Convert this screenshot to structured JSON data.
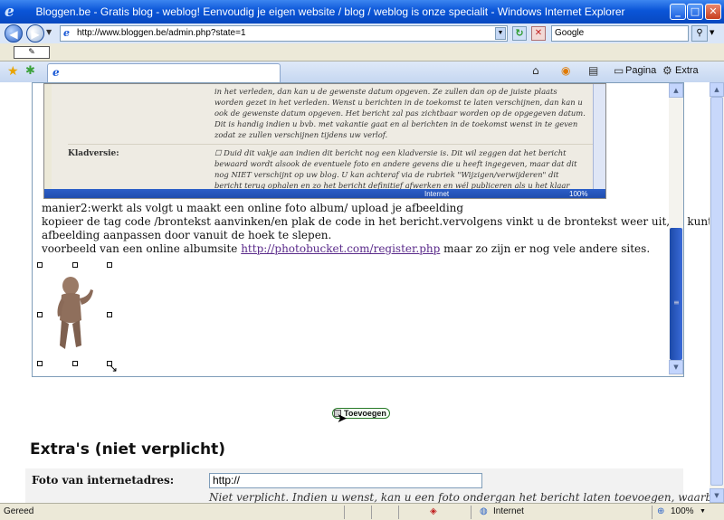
{
  "window": {
    "title": "Bloggen.be - Gratis blog - weblog! Eenvoudig je eigen website / blog / weblog is onze specialit - Windows Internet Explorer",
    "minimize_icon": "minimize-icon",
    "maximize_icon": "maximize-icon",
    "close_icon": "close-icon"
  },
  "navigation": {
    "url": "http://www.bloggen.be/admin.php?state=1",
    "search_value": "Google"
  },
  "tab": {
    "label": ""
  },
  "toolbar": {
    "page_label": "Pagina",
    "extra_label": "Extra"
  },
  "screenshot_embed": {
    "top_text": "in het verleden, dan kan u de gewenste datum opgeven. Ze zullen dan op de juiste plaats worden gezet in het verleden. Wenst u berichten in de toekomst te laten verschijnen, dan kan u ook de gewenste datum opgeven. Het bericht zal pas zichtbaar worden op de opgegeven datum. Dit is handig indien u bvb. met vakantie gaat en al berichten in de toekomst wenst in te geven zodat ze zullen verschijnen tijdens uw verlof.",
    "kladversie_label": "Kladversie:",
    "kladversie_text": "Duid dit vakje aan indien dit bericht nog een kladversie is. Dit wil zeggen dat het bericht bewaard wordt alsook de eventuele foto en andere gevens die u heeft ingegeven, maar dat dit nog NIET verschijnt op uw blog. U kan achteraf via de rubriek \"Wijzigen/verwijderen\" dit bericht terug ophalen en zo het bericht definitief afwerken en wél publiceren als u het klaar acht.",
    "status_zone": "Internet",
    "status_zoom": "100%"
  },
  "editor": {
    "line1": "manier2:werkt als volgt u maakt een online foto album/ upload je afbeelding",
    "line2": "kopieer de tag code /brontekst aanvinken/en plak de code in het bericht.vervolgens vinkt u de brontekst weer uit,nu kunt u het formaat van de",
    "line3": "afbeelding aanpassen door vanuit de hoek te slepen.",
    "line4_prefix": "voorbeeld van een online albumsite ",
    "line4_link": "http://photobucket.com/register.php",
    "line4_suffix": " maar zo zijn er nog vele andere sites."
  },
  "form": {
    "add_button": "Toevoegen",
    "extras_heading": "Extra's (niet verplicht)",
    "foto_label": "Foto van internetadres:",
    "foto_value": "http://",
    "foto_help": "Niet verplicht. Indien u wenst, kan u een foto ondergan het bericht laten toevoegen, waarbij de foto op"
  },
  "statusbar": {
    "status": "Gereed",
    "zone": "Internet",
    "zoom": "100%"
  }
}
